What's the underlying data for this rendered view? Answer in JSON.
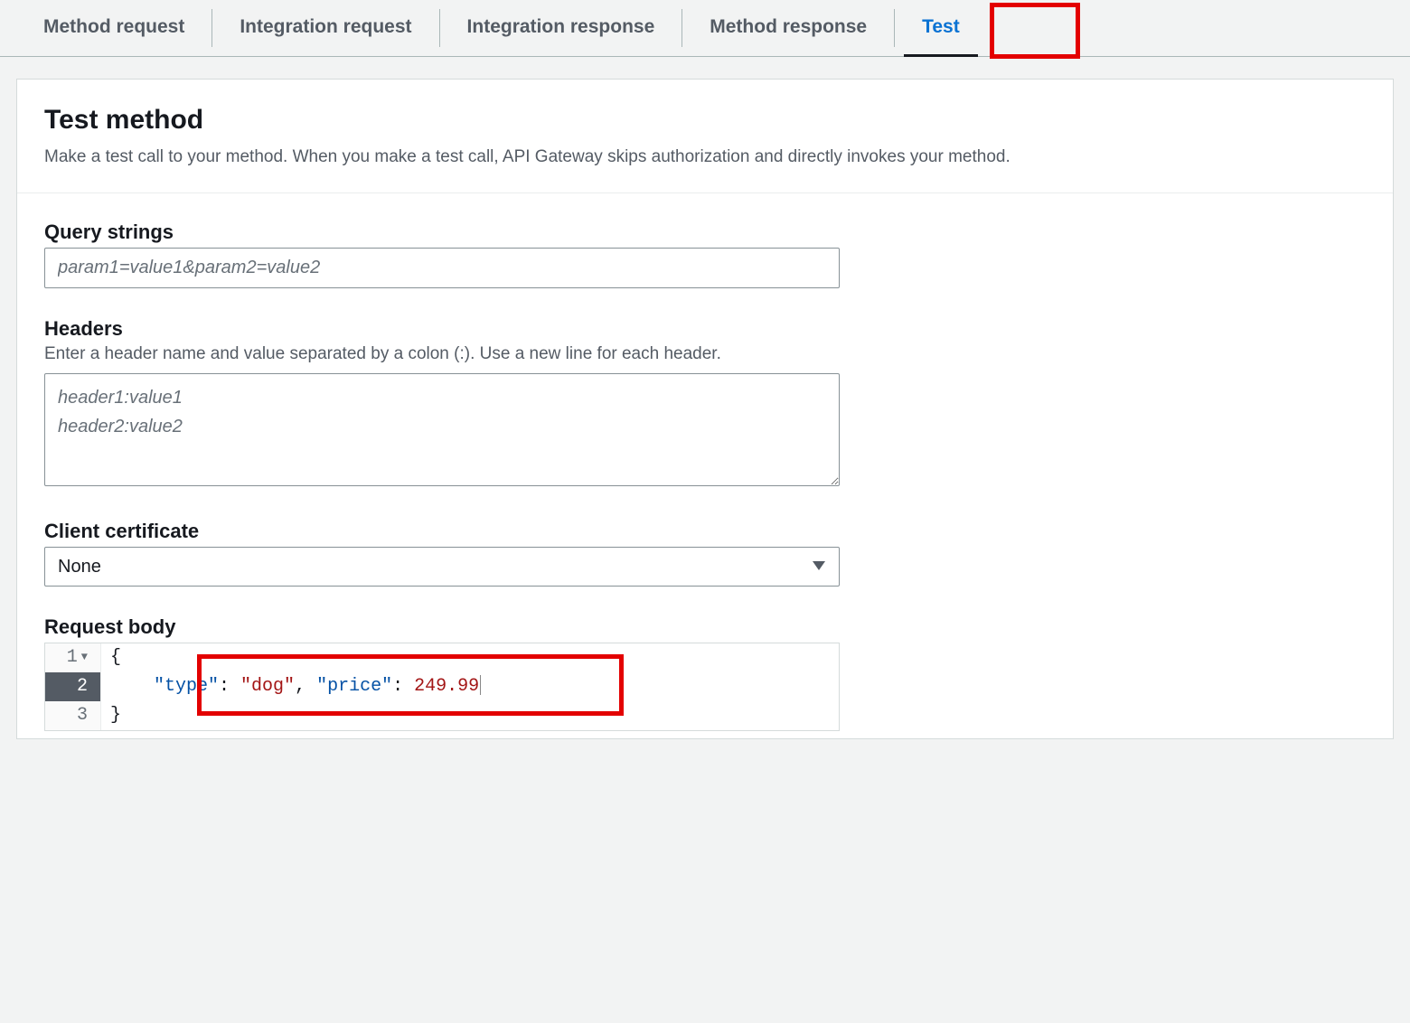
{
  "tabs": {
    "method_request": "Method request",
    "integration_request": "Integration request",
    "integration_response": "Integration response",
    "method_response": "Method response",
    "test": "Test"
  },
  "header": {
    "title": "Test method",
    "description": "Make a test call to your method. When you make a test call, API Gateway skips authorization and directly invokes your method."
  },
  "query_strings": {
    "label": "Query strings",
    "placeholder": "param1=value1&param2=value2",
    "value": ""
  },
  "headers": {
    "label": "Headers",
    "hint": "Enter a header name and value separated by a colon (:). Use a new line for each header.",
    "placeholder": "header1:value1\nheader2:value2",
    "value": ""
  },
  "client_certificate": {
    "label": "Client certificate",
    "selected": "None"
  },
  "request_body": {
    "label": "Request body",
    "line1_num": "1",
    "line2_num": "2",
    "line3_num": "3",
    "brace_open": "{",
    "brace_close": "}",
    "key_type": "\"type\"",
    "val_type": "\"dog\"",
    "key_price": "\"price\"",
    "val_price": "249.99",
    "colon": ": ",
    "comma": ", "
  }
}
